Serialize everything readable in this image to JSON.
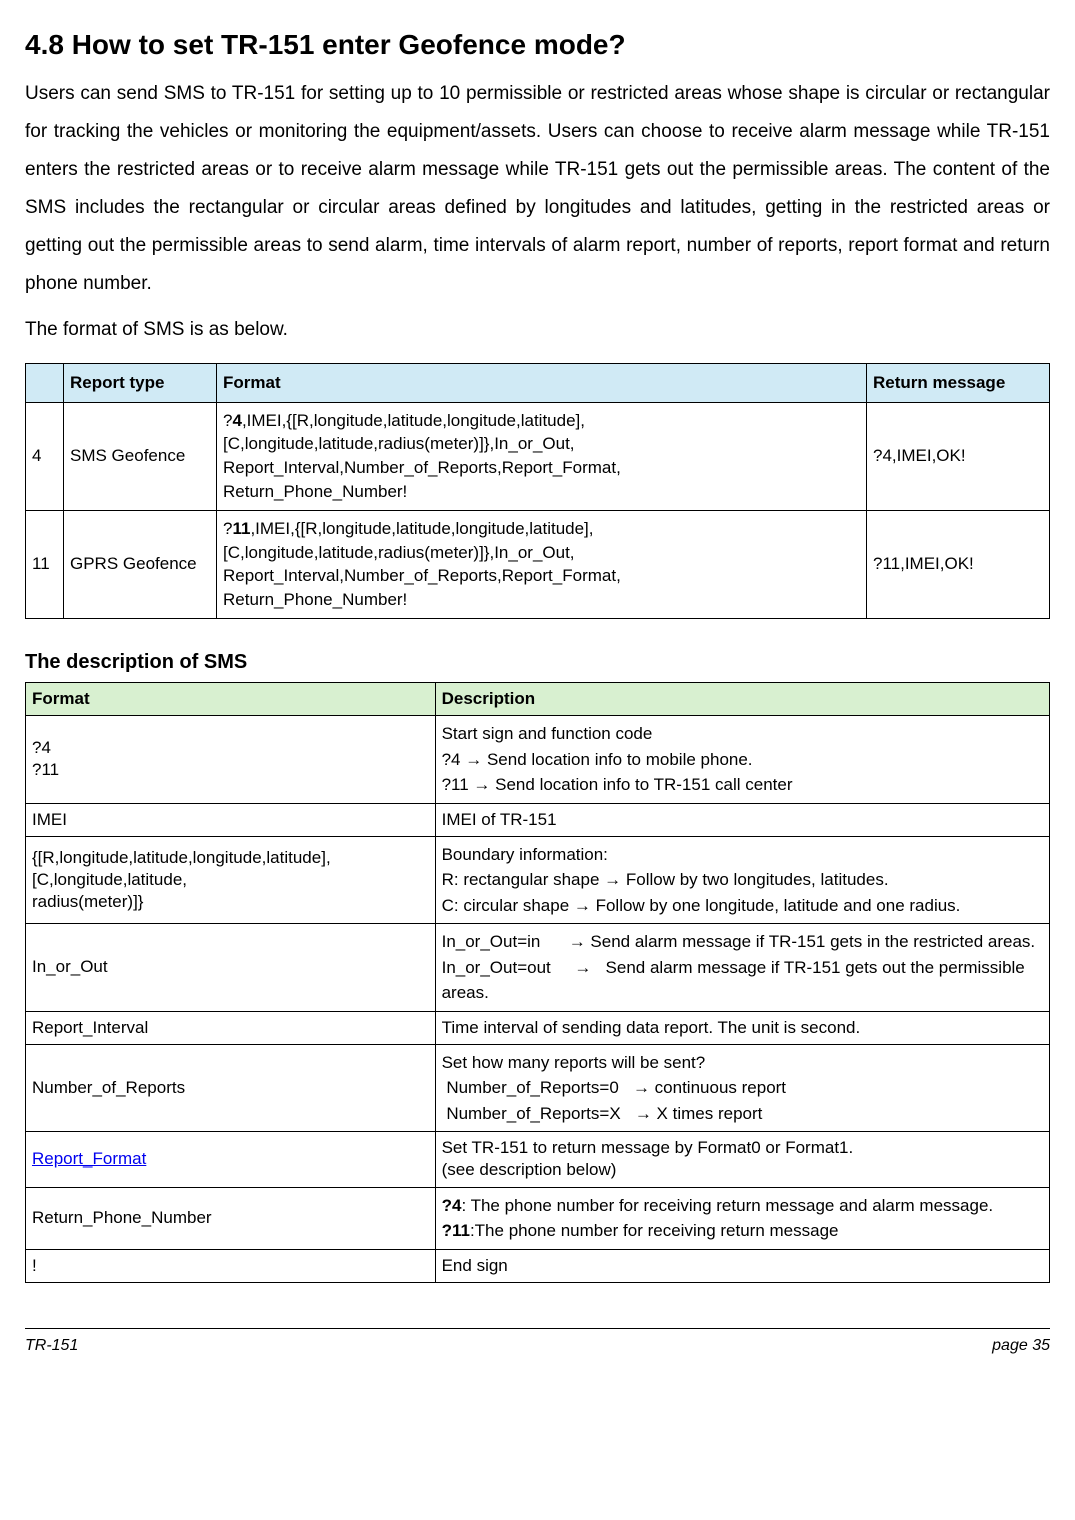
{
  "heading": "4.8 How to set TR-151 enter Geofence mode?",
  "intro": "Users can send SMS to TR-151 for setting up to 10 permissible or restricted areas whose shape is circular or rectangular for tracking the vehicles or monitoring the equipment/assets. Users can choose to receive alarm message while TR-151 enters the restricted areas or to receive alarm message while TR-151 gets out the permissible areas. The content of the SMS includes the rectangular or circular areas defined by longitudes and latitudes, getting in the restricted areas or getting out the permissible areas to send alarm, time intervals of alarm report, number of reports, report format and return phone number.",
  "format_intro": "The format of SMS is as below.",
  "table1": {
    "headers": {
      "col0": "",
      "col1": "Report type",
      "col2": "Format",
      "col3": "Return message"
    },
    "rows": [
      {
        "num": "4",
        "type": "SMS Geofence",
        "format_prefix": "?",
        "format_bold": "4",
        "format_rest": ",IMEI,{[R,longitude,latitude,longitude,latitude],\n[C,longitude,latitude,radius(meter)]},In_or_Out,\nReport_Interval,Number_of_Reports,Report_Format,\nReturn_Phone_Number!",
        "return": "?4,IMEI,OK!"
      },
      {
        "num": "11",
        "type": "GPRS Geofence",
        "format_prefix": "?",
        "format_bold": "11",
        "format_rest": ",IMEI,{[R,longitude,latitude,longitude,latitude],\n[C,longitude,latitude,radius(meter)]},In_or_Out,\nReport_Interval,Number_of_Reports,Report_Format,\nReturn_Phone_Number!",
        "return": "?11,IMEI,OK!"
      }
    ]
  },
  "section2_title": "The description of SMS",
  "table2": {
    "headers": {
      "format": "Format",
      "description": "Description"
    },
    "rows": {
      "r1": {
        "format": "?4\n?11",
        "desc_l1": "Start sign and function code",
        "desc_l2": "?4 → Send location info to mobile phone.",
        "desc_l3": "?11 → Send location info to TR-151 call center"
      },
      "r2": {
        "format": "IMEI",
        "desc": "IMEI of TR-151"
      },
      "r3": {
        "format": "{[R,longitude,latitude,longitude,latitude],[C,longitude,latitude,\nradius(meter)]}",
        "desc_l1": "Boundary information:",
        "desc_l2": "R: rectangular shape → Follow by two longitudes, latitudes.",
        "desc_l3": "C: circular shape → Follow by one longitude, latitude and one radius."
      },
      "r4": {
        "format": "In_or_Out",
        "desc_l1": "In_or_Out=in      → Send alarm message if TR-151 gets in the restricted areas.",
        "desc_l2": "In_or_Out=out     →   Send alarm message if TR-151 gets out the permissible areas."
      },
      "r5": {
        "format": "Report_Interval",
        "desc": "Time interval of sending data report. The unit is second."
      },
      "r6": {
        "format": "Number_of_Reports",
        "desc_l1": "Set how many reports will be sent?",
        "desc_l2": " Number_of_Reports=0   → continuous report",
        "desc_l3": " Number_of_Reports=X   → X times report"
      },
      "r7": {
        "format": "Report_Format",
        "desc": "Set TR-151 to return message by Format0 or Format1.\n(see description below)"
      },
      "r8": {
        "format": "Return_Phone_Number",
        "desc_b1": "?4",
        "desc_t1": ": The phone number for receiving return message and alarm message.",
        "desc_b2": "?11",
        "desc_t2": ":The phone number for receiving return message"
      },
      "r9": {
        "format": "!",
        "desc": "End sign"
      }
    }
  },
  "footer": {
    "left": "TR-151",
    "right": "page 35"
  }
}
